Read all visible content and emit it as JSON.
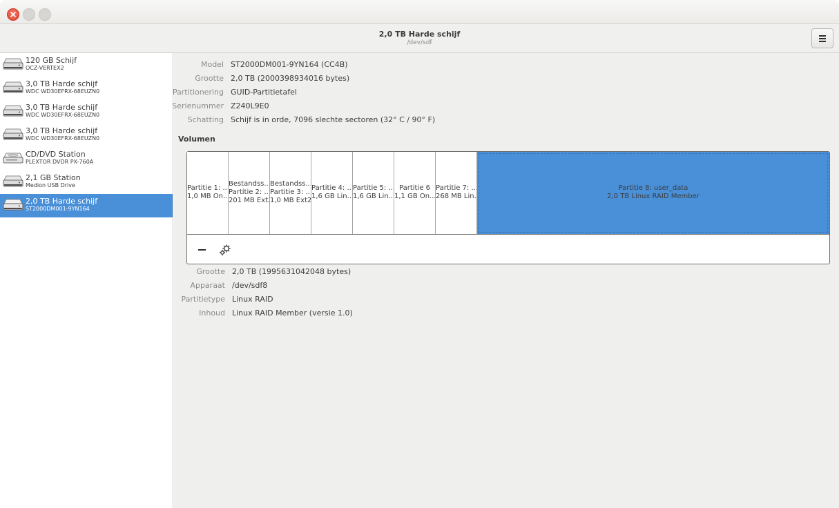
{
  "window": {
    "title": "2,0 TB Harde schijf",
    "subtitle": "/dev/sdf"
  },
  "sidebar": {
    "drives": [
      {
        "name": "120 GB Schijf",
        "model": "OCZ-VERTEX2",
        "icon": "hard-disk-icon"
      },
      {
        "name": "3,0 TB Harde schijf",
        "model": "WDC WD30EFRX-68EUZN0",
        "icon": "hard-disk-icon"
      },
      {
        "name": "3,0 TB Harde schijf",
        "model": "WDC WD30EFRX-68EUZN0",
        "icon": "hard-disk-icon"
      },
      {
        "name": "3,0 TB Harde schijf",
        "model": "WDC WD30EFRX-68EUZN0",
        "icon": "hard-disk-icon"
      },
      {
        "name": "CD/DVD Station",
        "model": "PLEXTOR DVDR   PX-760A",
        "icon": "optical-drive-icon"
      },
      {
        "name": "2,1 GB Station",
        "model": "Medion USB Drive",
        "icon": "hard-disk-icon"
      },
      {
        "name": "2,0 TB Harde schijf",
        "model": "ST2000DM001-9YN164",
        "icon": "hard-disk-icon",
        "selected": true
      }
    ]
  },
  "disk_info": [
    {
      "label": "Model",
      "value": "ST2000DM001-9YN164 (CC4B)"
    },
    {
      "label": "Grootte",
      "value": "2,0 TB (2000398934016 bytes)"
    },
    {
      "label": "Partitionering",
      "value": "GUID-Partitietafel"
    },
    {
      "label": "Serienummer",
      "value": "Z240L9E0"
    },
    {
      "label": "Schatting",
      "value": "Schijf is in orde, 7096 slechte sectoren (32° C / 90° F)"
    }
  ],
  "volumes": {
    "heading": "Volumen",
    "partitions": [
      {
        "line1": "",
        "line2": "Partitie 1: ...",
        "line3": "1,0 MB On..."
      },
      {
        "line1": "Bestandss...",
        "line2": "Partitie 2: ...",
        "line3": "201 MB Ext2"
      },
      {
        "line1": "Bestandss...",
        "line2": "Partitie 3: ...",
        "line3": "1,0 MB Ext2"
      },
      {
        "line1": "",
        "line2": "Partitie 4: ...",
        "line3": "1,6 GB Lin..."
      },
      {
        "line1": "",
        "line2": "Partitie 5: ...",
        "line3": "1,6 GB Lin..."
      },
      {
        "line1": "",
        "line2": "Partitie 6",
        "line3": "1,1 GB On..."
      },
      {
        "line1": "",
        "line2": "Partitie 7: ...",
        "line3": "268 MB Lin..."
      },
      {
        "line1": "",
        "line2": "Partitie 8: user_data",
        "line3": "2,0 TB Linux RAID Member",
        "selected": true
      }
    ],
    "toolbar": {
      "remove_icon": "minus-icon",
      "settings_icon": "gears-icon"
    }
  },
  "partition_info": [
    {
      "label": "Grootte",
      "value": "2,0 TB (1995631042048 bytes)"
    },
    {
      "label": "Apparaat",
      "value": "/dev/sdf8"
    },
    {
      "label": "Partitietype",
      "value": "Linux RAID"
    },
    {
      "label": "Inhoud",
      "value": "Linux RAID Member (versie 1.0)"
    }
  ],
  "colors": {
    "selection": "#4a90d9",
    "close_button": "#e0432f"
  }
}
